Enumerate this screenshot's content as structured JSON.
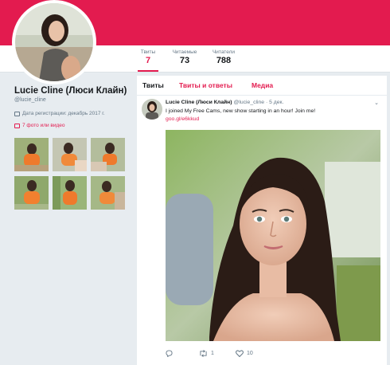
{
  "profile": {
    "name": "Lucie Cline (Люси Клайн)",
    "handle": "@lucie_cline",
    "joined": "Дата регистрации: декабрь 2017 г.",
    "media_link": "7 фото или видео"
  },
  "stats": [
    {
      "label": "Твиты",
      "value": "7"
    },
    {
      "label": "Читаемые",
      "value": "73"
    },
    {
      "label": "Читатели",
      "value": "788"
    }
  ],
  "tabs": [
    "Твиты",
    "Твиты и ответы",
    "Медиа"
  ],
  "tweet": {
    "name": "Lucie Cline (Люси Клайн)",
    "meta": "@lucie_cline · 5 дек.",
    "text": "I joined My Free Cams, new show starting in an hour! Join me!",
    "link": "goo.gl/e6kkud",
    "retweets": "1",
    "likes": "10"
  },
  "colors": {
    "accent": "#e31b4f",
    "banner": "#e31b4f",
    "page_bg": "#e7ecf0",
    "muted_text": "#657786"
  },
  "icons": [
    "calendar-icon",
    "media-icon",
    "reply-icon",
    "retweet-icon",
    "like-icon",
    "chevron-down-icon"
  ]
}
